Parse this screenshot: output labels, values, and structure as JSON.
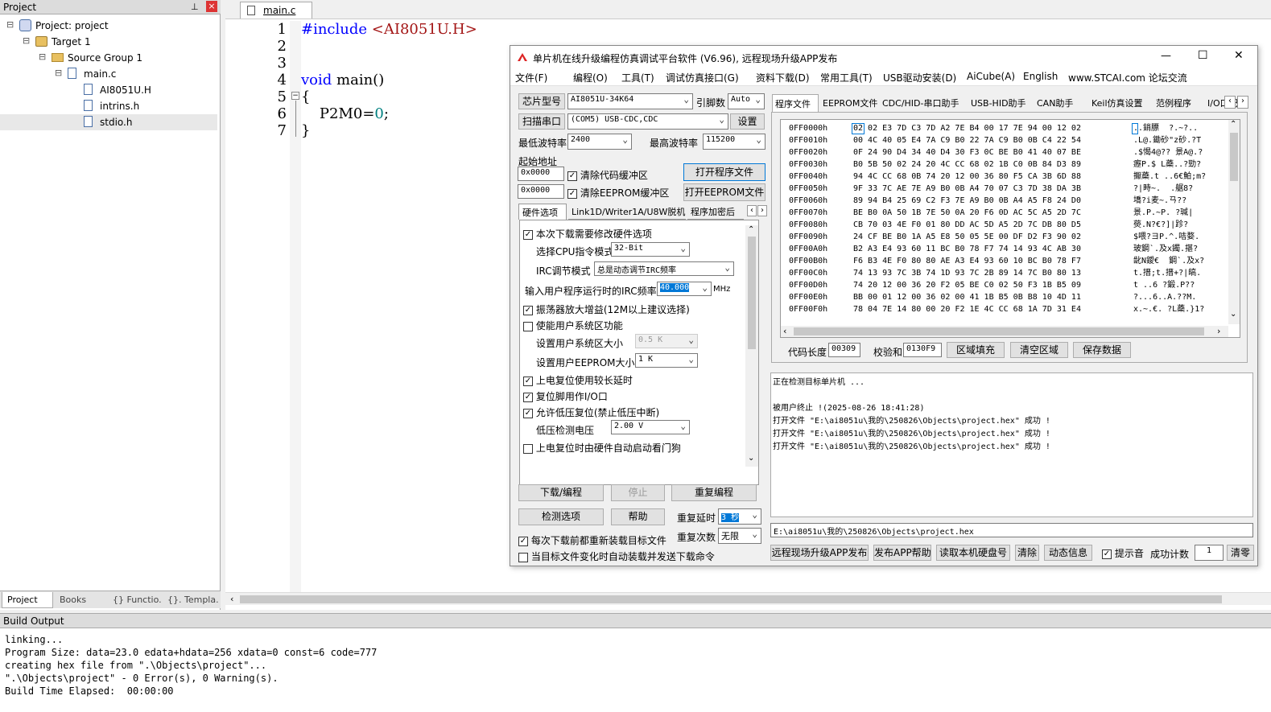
{
  "project_panel": {
    "title": "Project",
    "pin": "⊥",
    "close": "×",
    "tree": [
      {
        "label": "Project: project",
        "indent": 0,
        "toggle": "⊟",
        "icon": "project-icon"
      },
      {
        "label": "Target 1",
        "indent": 1,
        "toggle": "⊟",
        "icon": "target-icon"
      },
      {
        "label": "Source Group 1",
        "indent": 2,
        "toggle": "⊟",
        "icon": "folder-icon"
      },
      {
        "label": "main.c",
        "indent": 3,
        "toggle": "⊟",
        "icon": "file-icon"
      },
      {
        "label": "AI8051U.H",
        "indent": 4,
        "toggle": "",
        "icon": "file-icon"
      },
      {
        "label": "intrins.h",
        "indent": 4,
        "toggle": "",
        "icon": "file-icon"
      },
      {
        "label": "stdio.h",
        "indent": 4,
        "toggle": "",
        "icon": "file-icon"
      }
    ],
    "tabs": [
      "Project",
      "Books",
      "{} Functio...",
      "{}. Templa..."
    ]
  },
  "editor": {
    "tab": "main.c",
    "line_numbers": [
      "1",
      "2",
      "3",
      "4",
      "5",
      "6",
      "7"
    ],
    "code": [
      {
        "parts": [
          {
            "t": "#include ",
            "c": "#0000ff"
          },
          {
            "t": "<AI8051U.H>",
            "c": "#a31515"
          }
        ]
      },
      {
        "parts": []
      },
      {
        "parts": []
      },
      {
        "parts": [
          {
            "t": "void",
            "c": "#0000ff"
          },
          {
            "t": " main()",
            "c": "#000"
          }
        ]
      },
      {
        "parts": [
          {
            "t": "{",
            "c": "#000"
          }
        ]
      },
      {
        "parts": [
          {
            "t": "    P2M0=",
            "c": "#000"
          },
          {
            "t": "0",
            "c": "#008080"
          },
          {
            "t": ";",
            "c": "#000"
          }
        ]
      },
      {
        "parts": [
          {
            "t": "}",
            "c": "#000"
          }
        ]
      }
    ]
  },
  "build_output": {
    "title": "Build Output",
    "lines": [
      "linking...",
      "Program Size: data=23.0 edata+hdata=256 xdata=0 const=6 code=777",
      "creating hex file from \".\\Objects\\project\"...",
      "\".\\Objects\\project\" - 0 Error(s), 0 Warning(s).",
      "Build Time Elapsed:  00:00:00"
    ]
  },
  "isp": {
    "title": "单片机在线升级编程仿真调试平台软件 (V6.96), 远程现场升级APP发布",
    "win_min": "—",
    "win_max": "☐",
    "win_close": "✕",
    "menu": [
      "文件(F)",
      "编程(O)",
      "工具(T)",
      "调试仿真接口(G)",
      "资料下载(D)",
      "常用工具(T)",
      "USB驱动安装(D)",
      "AiCube(A)",
      "English",
      "www.STCAI.com 论坛交流"
    ],
    "chip_label": "芯片型号",
    "chip_value": "AI8051U-34K64",
    "pins_label": "引脚数",
    "pins_value": "Auto",
    "scan_label": "扫描串口",
    "port_value": "(COM5) USB-CDC,CDC",
    "settings_label": "设置",
    "min_baud_label": "最低波特率",
    "min_baud": "2400",
    "max_baud_label": "最高波特率",
    "max_baud": "115200",
    "start_addr_label": "起始地址",
    "addr1": "0x0000",
    "addr2": "0x0000",
    "clear_code": "清除代码缓冲区",
    "clear_eeprom": "清除EEPROM缓冲区",
    "open_prog": "打开程序文件",
    "open_eeprom": "打开EEPROM文件",
    "hw_tabs": [
      "硬件选项",
      "Link1D/Writer1A/U8W脱机",
      "程序加密后"
    ],
    "hw_options": {
      "modify_hw": "本次下载需要修改硬件选项",
      "cpu_mode_label": "选择CPU指令模式",
      "cpu_mode": "32-Bit",
      "irc_mode_label": "IRC调节模式",
      "irc_mode": "总是动态调节IRC频率",
      "irc_freq_label": "输入用户程序运行时的IRC频率",
      "irc_freq": "40.000",
      "irc_unit": "MHz",
      "osc_gain": "振荡器放大增益(12M以上建议选择)",
      "user_sys": "使能用户系统区功能",
      "sys_size_label": "设置用户系统区大小",
      "sys_size": "0.5 K",
      "eeprom_size_label": "设置用户EEPROM大小",
      "eeprom_size": "1  K",
      "long_reset": "上电复位使用较长延时",
      "reset_io": "复位脚用作I/O口",
      "low_volt_reset": "允许低压复位(禁止低压中断)",
      "low_volt_label": "低压检测电压",
      "low_volt": "2.00 V",
      "watchdog": "上电复位时由硬件自动启动看门狗"
    },
    "download_btn": "下载/编程",
    "stop_btn": "停止",
    "reprogram_btn": "重复编程",
    "check_btn": "检测选项",
    "help_btn": "帮助",
    "delay_label": "重复延时",
    "delay_value": "3 秒",
    "count_label": "重复次数",
    "count_value": "无限",
    "reload_label": "每次下载前都重新装载目标文件",
    "auto_label": "当目标文件变化时自动装载并发送下载命令",
    "right_tabs": [
      "程序文件",
      "EEPROM文件",
      "CDC/HID-串口助手",
      "USB-HID助手",
      "CAN助手",
      "Keil仿真设置",
      "范例程序",
      "I/O口配置"
    ],
    "hex_rows": [
      {
        "addr": "0FF0000h",
        "bytes": "02 02 E3 7D C3 7D A2 7E B4 00 17 7E 94 00 12 02",
        "ascii": "..銷膘  ?.~?.."
      },
      {
        "addr": "0FF0010h",
        "bytes": "00 4C 40 05 E4 7A C9 B0 22 7A C9 B0 0B C4 22 54",
        "ascii": ".L@.鋤砂\"z砂.?T"
      },
      {
        "addr": "0FF0020h",
        "bytes": "0F 24 90 D4 34 40 D4 30 F3 0C BE B0 41 40 07 BE",
        "ascii": ".$愒4@?? 景A@.?"
      },
      {
        "addr": "0FF0030h",
        "bytes": "B0 5B 50 02 24 20 4C CC 68 02 1B C0 0B 84 D3 89",
        "ascii": "癧P.$ L蘃..?勁?"
      },
      {
        "addr": "0FF0040h",
        "bytes": "94 4C CC 68 0B 74 20 12 00 36 80 F5 CA 3B 6D 88",
        "ascii": "擫蘃.t ..6€鮊;m?"
      },
      {
        "addr": "0FF0050h",
        "bytes": "9F 33 7C AE 7E A9 B0 0B A4 70 07 C3 7D 38 DA 3B",
        "ascii": "?|畤~.  .艍8?"
      },
      {
        "addr": "0FF0060h",
        "bytes": "89 94 B4 25 69 C2 F3 7E A9 B0 0B A4 A5 F8 24 D0",
        "ascii": "墧?i麦~.ㄢ?? "
      },
      {
        "addr": "0FF0070h",
        "bytes": "BE B0 0A 50 1B 7E 50 0A 20 F6 0D AC 5C A5 2D 7C",
        "ascii": "景.P.~P. ?瑊|"
      },
      {
        "addr": "0FF0080h",
        "bytes": "CB 70 03 4E F0 01 80 DD AC 5D A5 2D 7C DB 80 D5",
        "ascii": "藀.N?€?]|跈?"
      },
      {
        "addr": "0FF0090h",
        "bytes": "24 CF BE B0 1A A5 E8 50 05 5E 00 DF D2 F3 90 02",
        "ascii": "$喂?ヨP.^.咭婺."
      },
      {
        "addr": "0FF00A0h",
        "bytes": "B2 A3 E4 93 60 11 BC B0 78 F7 74 14 93 4C AB 30",
        "ascii": "玻鋼`.及x鐲.揕?"
      },
      {
        "addr": "0FF00B0h",
        "bytes": "F6 B3 4E F0 80 80 AE A3 E4 93 60 10 BC B0 78 F7",
        "ascii": "龀N鑀€  鋼`.及x?"
      },
      {
        "addr": "0FF00C0h",
        "bytes": "74 13 93 7C 3B 74 1D 93 7C 2B 89 14 7C B0 80 13",
        "ascii": "t.搢;t.搢+?|皜."
      },
      {
        "addr": "0FF00D0h",
        "bytes": "74 20 12 00 36 20 F2 05 BE C0 02 50 F3 1B B5 09",
        "ascii": "t ..6 ?鍛.P??"
      },
      {
        "addr": "0FF00E0h",
        "bytes": "BB 00 01 12 00 36 02 00 41 1B B5 0B B8 10 4D 11",
        "ascii": "?...6..A.??M."
      },
      {
        "addr": "0FF00F0h",
        "bytes": "78 04 7E 14 80 00 20 F2 1E 4C CC 68 1A 7D 31 E4",
        "ascii": "x.~.€. ?L蘃.}1?"
      }
    ],
    "code_len_label": "代码长度",
    "code_len": "00309",
    "checksum_label": "校验和",
    "checksum": "0130F9",
    "fill_btn": "区域填充",
    "clear_area_btn": "清空区域",
    "save_btn": "保存数据",
    "log": [
      "正在检测目标单片机 ...",
      "",
      "被用户终止 !(2025-08-26 18:41:28)",
      "打开文件 \"E:\\ai8051u\\我的\\250826\\Objects\\project.hex\" 成功 !",
      "打开文件 \"E:\\ai8051u\\我的\\250826\\Objects\\project.hex\" 成功 !",
      "打开文件 \"E:\\ai8051u\\我的\\250826\\Objects\\project.hex\" 成功 !"
    ],
    "path": "E:\\ai8051u\\我的\\250826\\Objects\\project.hex",
    "bottom_btns": [
      "远程现场升级APP发布",
      "发布APP帮助",
      "读取本机硬盘号",
      "清除",
      "动态信息"
    ],
    "hint_label": "提示音",
    "success_label": "成功计数",
    "success_count": "1",
    "clear_count": "清零"
  }
}
